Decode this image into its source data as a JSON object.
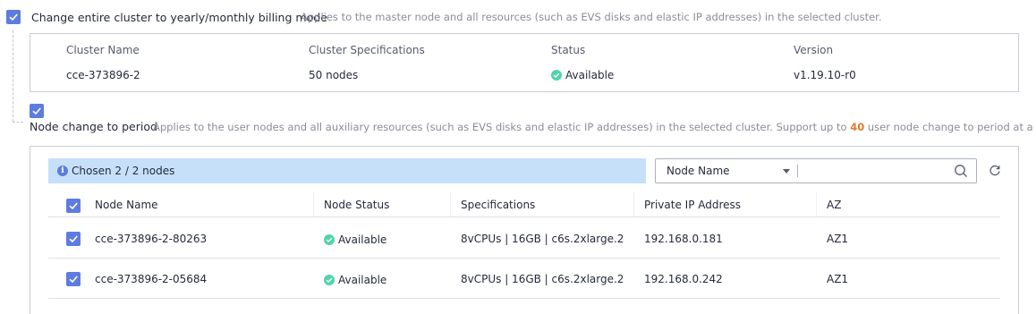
{
  "cluster_billing": {
    "checked": true,
    "label": "Change entire cluster to yearly/monthly billing mode",
    "description": "Applies to the master node and all resources (such as EVS disks and elastic IP addresses) in the selected cluster."
  },
  "cluster_table": {
    "headers": {
      "name": "Cluster Name",
      "spec": "Cluster Specifications",
      "status": "Status",
      "version": "Version"
    },
    "row": {
      "name": "cce-373896-2",
      "spec": "50 nodes",
      "status": "Available",
      "version": "v1.19.10-r0"
    }
  },
  "node_change": {
    "checked": true,
    "label": "Node change to period",
    "description_before": "Applies to the user nodes and all auxiliary resources (such as EVS disks and elastic IP addresses) in the selected cluster. Support up to",
    "limit": "40",
    "description_after": "user node change to period at a time"
  },
  "chosen": {
    "text": "Chosen 2 / 2 nodes"
  },
  "search": {
    "field": "Node Name",
    "value": ""
  },
  "node_table": {
    "headers": {
      "name": "Node Name",
      "status": "Node Status",
      "spec": "Specifications",
      "ip": "Private IP Address",
      "az": "AZ"
    },
    "rows": [
      {
        "checked": true,
        "name": "cce-373896-2-80263",
        "status": "Available",
        "spec": "8vCPUs | 16GB | c6s.2xlarge.2",
        "ip": "192.168.0.181",
        "az": "AZ1"
      },
      {
        "checked": true,
        "name": "cce-373896-2-05684",
        "status": "Available",
        "spec": "8vCPUs | 16GB | c6s.2xlarge.2",
        "ip": "192.168.0.242",
        "az": "AZ1"
      }
    ]
  },
  "colors": {
    "accent": "#5e7ce0",
    "success": "#50d4ab",
    "highlight": "#e27a2e",
    "info_bar": "#c7e0fa"
  },
  "icons": [
    "checkbox-checked-icon",
    "check-circle-icon",
    "info-icon",
    "caret-down-icon",
    "search-icon",
    "refresh-icon"
  ]
}
